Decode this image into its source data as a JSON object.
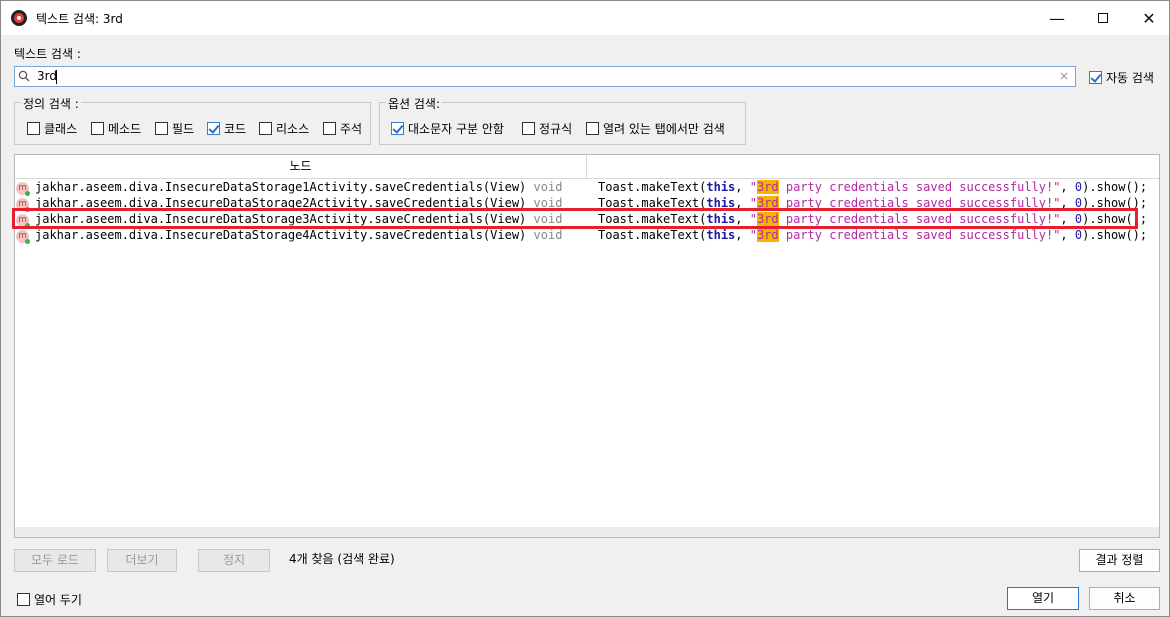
{
  "window": {
    "title": "텍스트 검색: 3rd",
    "minimize_glyph": "—",
    "close_glyph": "✕"
  },
  "search": {
    "label": "텍스트 검색 :",
    "value": "3rd",
    "clear_glyph": "×",
    "auto_search_label": "자동 검색",
    "auto_search_checked": true
  },
  "definition_search": {
    "title": "정의 검색 :",
    "options": [
      {
        "label": "클래스",
        "checked": false
      },
      {
        "label": "메소드",
        "checked": false
      },
      {
        "label": "필드",
        "checked": false
      },
      {
        "label": "코드",
        "checked": true
      },
      {
        "label": "리소스",
        "checked": false
      },
      {
        "label": "주석",
        "checked": false
      }
    ]
  },
  "option_search": {
    "title": "옵션 검색:",
    "options": [
      {
        "label": "대소문자 구분 안함",
        "checked": true
      },
      {
        "label": "정규식",
        "checked": false
      },
      {
        "label": "열려 있는 탭에서만 검색",
        "checked": false
      }
    ]
  },
  "results": {
    "column_header": "노드",
    "rows": [
      {
        "icon": "m",
        "node": "jakhar.aseem.diva.InsecureDataStorage1Activity.saveCredentials(View)",
        "return_type": "void",
        "code": {
          "prefix": "Toast.makeText(",
          "kw": "this",
          "sep": ", ",
          "quote_open": "\"",
          "match": "3rd",
          "string_rest": " party credentials saved successfully!\"",
          "comma": ", ",
          "num": "0",
          "suffix": ").show();"
        }
      },
      {
        "icon": "m",
        "node": "jakhar.aseem.diva.InsecureDataStorage2Activity.saveCredentials(View)",
        "return_type": "void",
        "code": {
          "prefix": "Toast.makeText(",
          "kw": "this",
          "sep": ", ",
          "quote_open": "\"",
          "match": "3rd",
          "string_rest": " party credentials saved successfully!\"",
          "comma": ", ",
          "num": "0",
          "suffix": ").show();"
        }
      },
      {
        "icon": "m",
        "node": "jakhar.aseem.diva.InsecureDataStorage3Activity.saveCredentials(View)",
        "return_type": "void",
        "code": {
          "prefix": "Toast.makeText(",
          "kw": "this",
          "sep": ", ",
          "quote_open": "\"",
          "match": "3rd",
          "string_rest": " party credentials saved successfully!\"",
          "comma": ", ",
          "num": "0",
          "suffix": ").show();"
        }
      },
      {
        "icon": "m",
        "node": "jakhar.aseem.diva.InsecureDataStorage4Activity.saveCredentials(View)",
        "return_type": "void",
        "code": {
          "prefix": "Toast.makeText(",
          "kw": "this",
          "sep": ", ",
          "quote_open": "\"",
          "match": "3rd",
          "string_rest": " party credentials saved successfully!\"",
          "comma": ", ",
          "num": "0",
          "suffix": ").show();"
        }
      }
    ]
  },
  "footer": {
    "load_all": "모두 로드",
    "more": "더보기",
    "stop": "정지",
    "status": "4개 찾음 (검색 완료)",
    "sort_results": "결과 정렬",
    "keep_open_label": "열어 두기",
    "keep_open_checked": false,
    "open": "열기",
    "cancel": "취소"
  },
  "colors": {
    "highlight": "#f5b400",
    "selection_outline": "#e4202e",
    "keyword": "#1a1aa6",
    "string": "#b02aa0"
  }
}
